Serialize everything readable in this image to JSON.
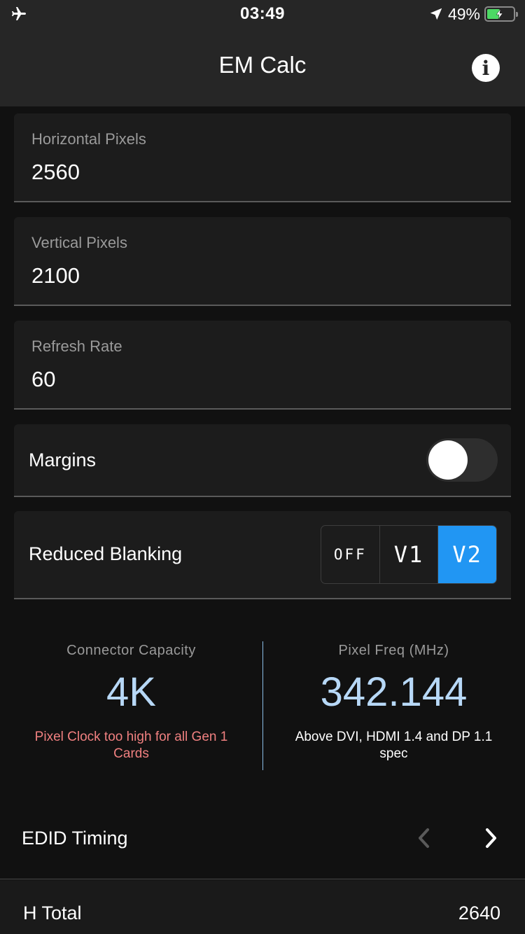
{
  "status_bar": {
    "time": "03:49",
    "battery_percent": "49%",
    "battery_level": 0.49,
    "icons": [
      "airplane-icon",
      "location-arrow-icon",
      "battery-charging-icon"
    ]
  },
  "nav": {
    "title": "EM Calc",
    "info_icon": "i"
  },
  "fields": {
    "horizontal": {
      "label": "Horizontal Pixels",
      "value": "2560"
    },
    "vertical": {
      "label": "Vertical Pixels",
      "value": "2100"
    },
    "refresh": {
      "label": "Refresh Rate",
      "value": "60"
    }
  },
  "margins": {
    "label": "Margins",
    "enabled": false
  },
  "reduced_blanking": {
    "label": "Reduced Blanking",
    "options": [
      "OFF",
      "V1",
      "V2"
    ],
    "selected": "V2"
  },
  "stats": {
    "connector": {
      "caption": "Connector Capacity",
      "value": "4K",
      "note": "Pixel Clock too high for all Gen 1 Cards"
    },
    "pixel_freq": {
      "caption": "Pixel Freq (MHz)",
      "value": "342.144",
      "note": "Above DVI, HDMI 1.4 and DP 1.1 spec"
    }
  },
  "edid": {
    "label": "EDID Timing"
  },
  "h_total": {
    "label": "H Total",
    "value": "2640"
  },
  "colors": {
    "background": "#111111",
    "bar": "#262626",
    "card": "#1c1c1c",
    "accent": "#2196f3",
    "value_blue": "#b7d8f7",
    "warning": "#f08080"
  }
}
